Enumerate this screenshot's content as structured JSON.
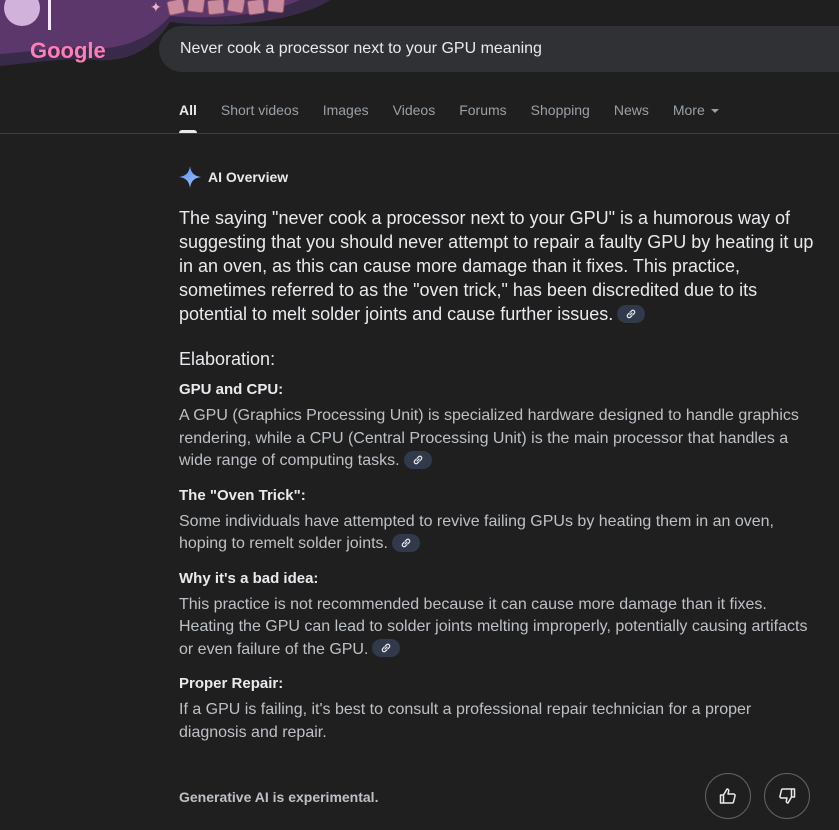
{
  "search": {
    "query": "Never cook a processor next to your GPU meaning"
  },
  "logo": {
    "text": "Google"
  },
  "tabs": [
    {
      "label": "All",
      "active": true
    },
    {
      "label": "Short videos"
    },
    {
      "label": "Images"
    },
    {
      "label": "Videos"
    },
    {
      "label": "Forums"
    },
    {
      "label": "Shopping"
    },
    {
      "label": "News"
    },
    {
      "label": "More"
    }
  ],
  "ai_overview": {
    "title": "AI Overview",
    "lead": "The saying \"never cook a processor next to your GPU\" is a humorous way of suggesting that you should never attempt to repair a faulty GPU by heating it up in an oven, as this can cause more damage than it fixes. This practice, sometimes referred to as the \"oven trick,\" has been discredited due to its potential to melt solder joints and cause further issues.",
    "elaboration_heading": "Elaboration:",
    "sections": [
      {
        "title": "GPU and CPU:",
        "body": "A GPU (Graphics Processing Unit) is specialized hardware designed to handle graphics rendering, while a CPU (Central Processing Unit) is the main processor that handles a wide range of computing tasks."
      },
      {
        "title": "The \"Oven Trick\":",
        "body": "Some individuals have attempted to revive failing GPUs by heating them in an oven, hoping to remelt solder joints."
      },
      {
        "title": "Why it's a bad idea:",
        "body": "This practice is not recommended because it can cause more damage than it fixes. Heating the GPU can lead to solder joints melting improperly, potentially causing artifacts or even failure of the GPU."
      },
      {
        "title": "Proper Repair:",
        "body": "If a GPU is failing, it's best to consult a professional repair technician for a proper diagnosis and repair."
      }
    ],
    "footer": "Generative AI is experimental."
  },
  "icons": [
    "gemini-sparkle-icon",
    "link-icon",
    "thumbs-up-icon",
    "thumbs-down-icon"
  ],
  "colors": {
    "background": "#1f1f1f",
    "search_bg": "#303134",
    "chip_bg": "#303a4a",
    "logo_pink": "#f06292"
  }
}
